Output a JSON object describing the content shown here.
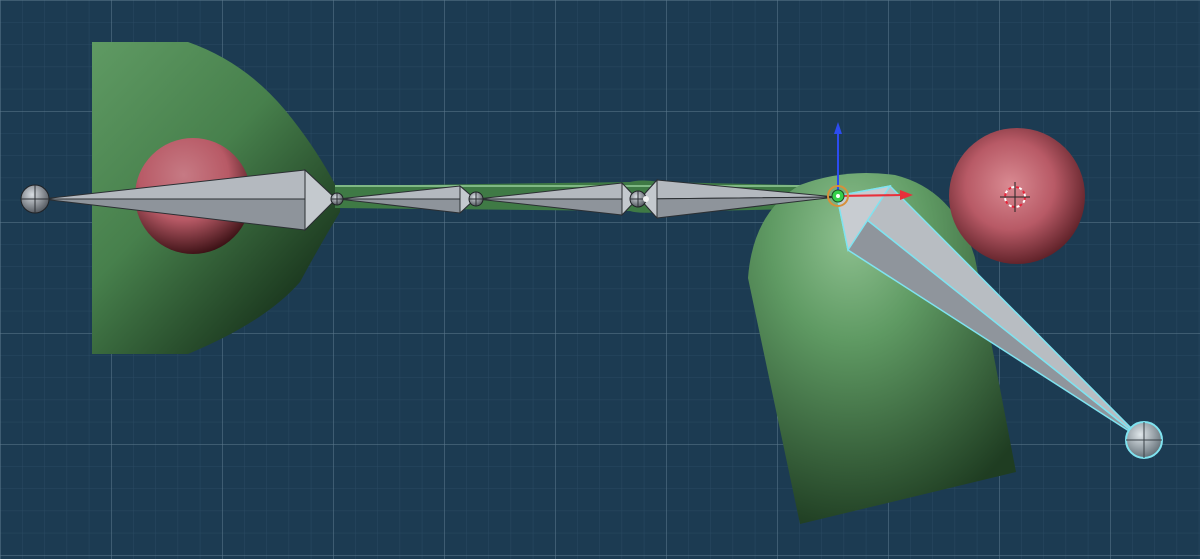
{
  "viewport": {
    "view": "3D Viewport",
    "shading": "solid",
    "grid": true
  },
  "colors": {
    "background": "#1c3b52",
    "grid_minor": "#2a4a62",
    "grid_major": "#5f7d90",
    "mesh_green": "#5f9a63",
    "mesh_green_dark": "#0f2412",
    "sphere_red": "#b85a66",
    "bone_gray": "#9aa0a8",
    "bone_dark": "#5f646c",
    "selection": "#7fe3f0",
    "x_axis": "#e8303a",
    "y_axis": "#35d04a",
    "z_axis": "#2c4cf0",
    "cursor": "#e8243a"
  },
  "scene": {
    "objects": [
      "deformed-mesh-left",
      "mesh-right-capsule",
      "red-sphere-left",
      "red-sphere-right"
    ],
    "armature": {
      "bone_count": 5,
      "active_bone": "bone-5"
    },
    "gizmo": "translate",
    "icons": [
      "3d-cursor-icon",
      "transform-gizmo-icon"
    ]
  }
}
